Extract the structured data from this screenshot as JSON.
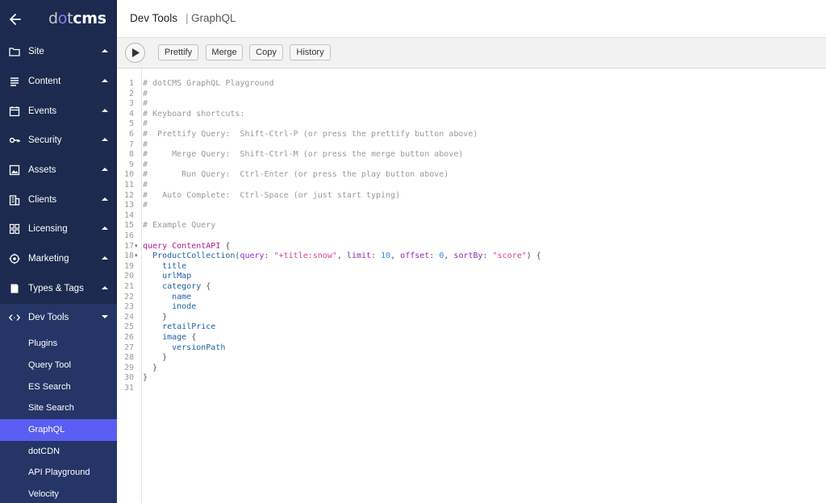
{
  "sidebar": {
    "logo": {
      "pre": "d",
      "mid": "o",
      "post_light": "t",
      "post": "cms"
    },
    "items": [
      {
        "label": "Site",
        "icon": "folder-icon"
      },
      {
        "label": "Content",
        "icon": "list-icon"
      },
      {
        "label": "Events",
        "icon": "calendar-icon"
      },
      {
        "label": "Security",
        "icon": "key-icon"
      },
      {
        "label": "Assets",
        "icon": "image-icon"
      },
      {
        "label": "Clients",
        "icon": "building-icon"
      },
      {
        "label": "Licensing",
        "icon": "grid-icon"
      },
      {
        "label": "Marketing",
        "icon": "target-icon"
      },
      {
        "label": "Types & Tags",
        "icon": "bookmark-icon"
      },
      {
        "label": "Dev Tools",
        "icon": "code-icon"
      }
    ],
    "subitems": [
      {
        "label": "Plugins"
      },
      {
        "label": "Query Tool"
      },
      {
        "label": "ES Search"
      },
      {
        "label": "Site Search"
      },
      {
        "label": "GraphQL"
      },
      {
        "label": "dotCDN"
      },
      {
        "label": "API Playground"
      },
      {
        "label": "Velocity"
      }
    ],
    "active_subitem": "GraphQL",
    "colors": {
      "bg": "#1b2a4e",
      "devtools_bg": "#243566",
      "active": "#5b5ef2"
    }
  },
  "header": {
    "section": "Dev Tools",
    "separator": "|",
    "page": "GraphQL"
  },
  "toolbar": {
    "prettify": "Prettify",
    "merge": "Merge",
    "copy": "Copy",
    "history": "History"
  },
  "editor": {
    "line_numbers": [
      "1",
      "2",
      "3",
      "4",
      "5",
      "6",
      "7",
      "8",
      "9",
      "10",
      "11",
      "12",
      "13",
      "14",
      "15",
      "16",
      "17",
      "18",
      "19",
      "20",
      "21",
      "22",
      "23",
      "24",
      "25",
      "26",
      "27",
      "28",
      "29",
      "30",
      "31"
    ],
    "lines": [
      "# dotCMS GraphQL Playground",
      "#",
      "#",
      "# Keyboard shortcuts:",
      "#",
      "#  Prettify Query:  Shift-Ctrl-P (or press the prettify button above)",
      "#",
      "#     Merge Query:  Shift-Ctrl-M (or press the merge button above)",
      "#",
      "#       Run Query:  Ctrl-Enter (or press the play button above)",
      "#",
      "#   Auto Complete:  Ctrl-Space (or just start typing)",
      "#",
      "",
      "# Example Query",
      "",
      "",
      "",
      "",
      "",
      "",
      "",
      "",
      "",
      "",
      "",
      "",
      "",
      "",
      "",
      ""
    ],
    "query": {
      "keyword": "query",
      "name": "ContentAPI",
      "collection": "ProductCollection",
      "args": [
        {
          "name": "query",
          "value": "\"+title:snow\""
        },
        {
          "name": "limit",
          "value": "10"
        },
        {
          "name": "offset",
          "value": "0"
        },
        {
          "name": "sortBy",
          "value": "\"score\""
        }
      ],
      "fields": {
        "title": "title",
        "urlMap": "urlMap",
        "category": "category",
        "name": "name",
        "inode": "inode",
        "retailPrice": "retailPrice",
        "image": "image",
        "versionPath": "versionPath"
      }
    }
  }
}
